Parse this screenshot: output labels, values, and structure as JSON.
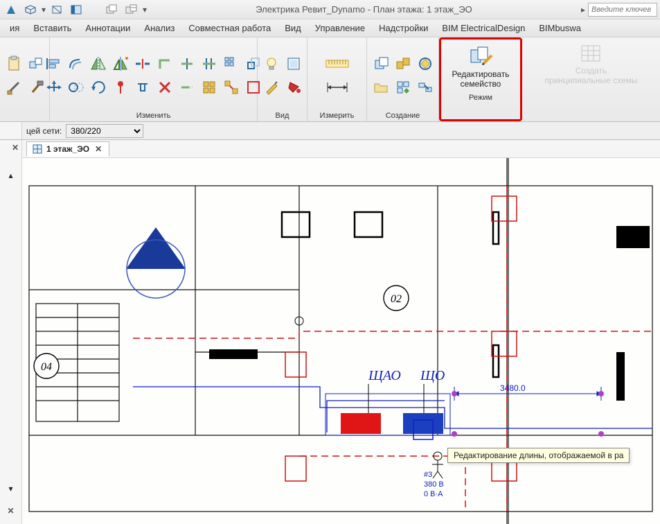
{
  "title": "Электрика Ревит_Dynamo - План этажа: 1 этаж_ЭО",
  "search_placeholder": "Введите ключев",
  "tabs": {
    "t0": "ия",
    "t1": "Вставить",
    "t2": "Аннотации",
    "t3": "Анализ",
    "t4": "Совместная работа",
    "t5": "Вид",
    "t6": "Управление",
    "t7": "Надстройки",
    "t8": "BIM ElectricalDesign",
    "t9": "BIMbuswa"
  },
  "panels": {
    "edit": "Изменить",
    "view": "Вид",
    "measure": "Измерить",
    "create": "Создание",
    "mode": "Режим"
  },
  "mode_button": {
    "line1": "Редактировать",
    "line2": "семейство"
  },
  "schematic_button": {
    "line1": "Создать",
    "line2": "принципиальные схемы"
  },
  "options": {
    "label": "цей сети:",
    "value": "380/220"
  },
  "view_tab": {
    "name": "1 этаж_ЭО"
  },
  "drawing": {
    "room_tag_02": "02",
    "room_tag_04": "04",
    "label_shao": "ЩАО",
    "label_sho": "ЩО",
    "dim_value": "3480.0",
    "panel_info_line1": "#3",
    "panel_info_line2": "380 В",
    "panel_info_line3": "0 В·А"
  },
  "tooltip": "Редактирование длины, отображаемой в ра",
  "colors": {
    "highlight": "#e00000",
    "panel_red": "#e01515",
    "panel_blue": "#1b3fbe",
    "draw_blue": "#1020c0",
    "draw_red": "#d01010"
  }
}
